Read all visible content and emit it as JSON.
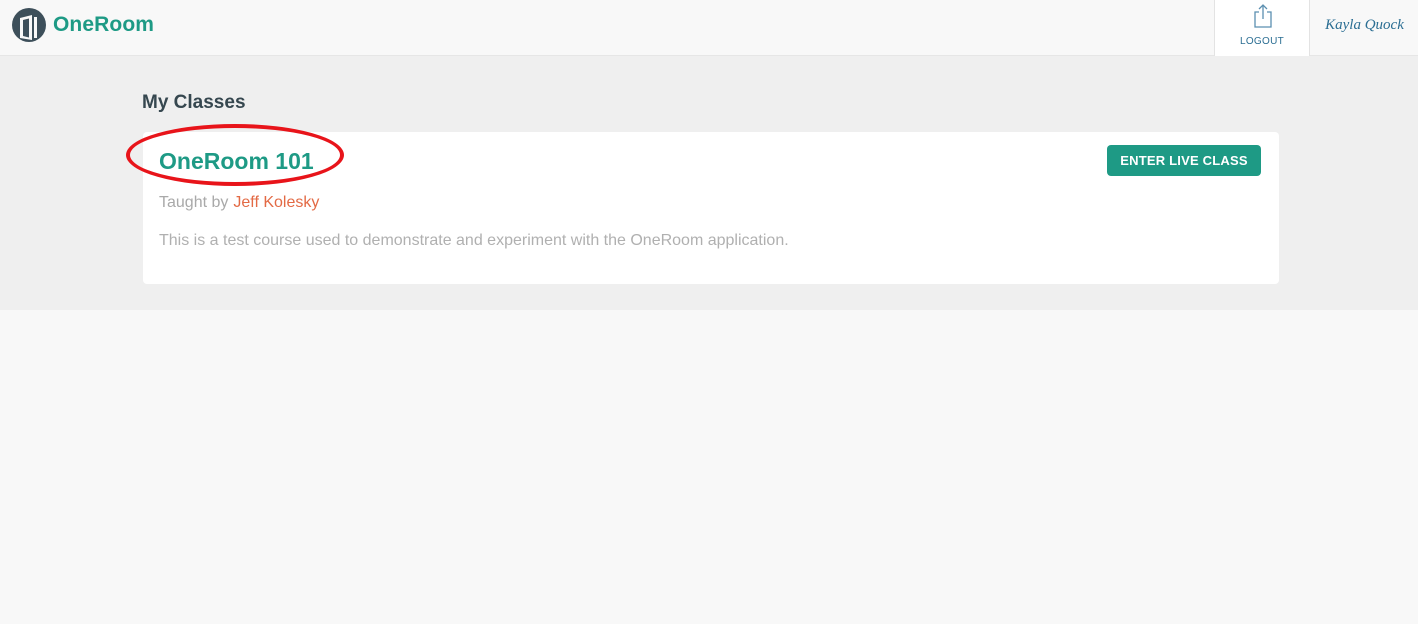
{
  "header": {
    "brand_name": "OneRoom",
    "brand_icon": "oneroom-door-logo",
    "logout_label": "LOGOUT",
    "logout_icon": "share-upload-icon",
    "user_name": "Kayla Quock"
  },
  "main": {
    "section_title": "My Classes",
    "classes": [
      {
        "title": "OneRoom 101",
        "taught_by_label": "Taught by",
        "teacher": "Jeff Kolesky",
        "description": "This is a test course used to demonstrate and experiment with the OneRoom application.",
        "enter_label": "ENTER LIVE CLASS"
      }
    ]
  },
  "colors": {
    "brand": "#1e9a85",
    "teacher_link": "#e36a45",
    "header_link": "#2b6e93",
    "highlight": "#e8141a"
  }
}
